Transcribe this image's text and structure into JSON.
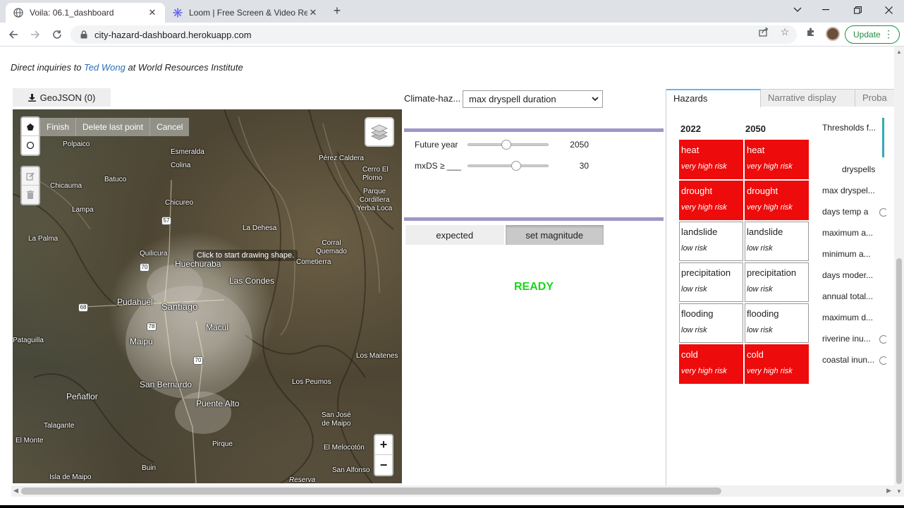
{
  "browser": {
    "tabs": [
      {
        "title": "Voila: 06.1_dashboard",
        "active": true
      },
      {
        "title": "Loom | Free Screen & Video Reco",
        "active": false
      }
    ],
    "url": "city-hazard-dashboard.herokuapp.com",
    "update_label": "Update"
  },
  "page": {
    "inquiry_prefix": "Direct inquiries to ",
    "inquiry_link": "Ted Wong",
    "inquiry_suffix": " at World Resources Institute"
  },
  "map": {
    "geojson_button": "GeoJSON (0)",
    "draw_actions": [
      "Finish",
      "Delete last point",
      "Cancel"
    ],
    "tooltip": "Click to start drawing shape.",
    "zoom_in": "+",
    "zoom_out": "−",
    "labels": {
      "polpaico": "Polpaico",
      "esmeralda": "Esmeralda",
      "colina": "Colina",
      "perez_caldera": "Pérez Caldera",
      "cerro_el_plomo": "Cerro El\nPlomo",
      "chicauma": "Chicauma",
      "batuco": "Batuco",
      "lampa": "Lampa",
      "parque_cordillera": "Parque\nCordillera\nYerba Loca",
      "chicureo": "Chicureo",
      "la_dehesa": "La Dehesa",
      "la_palma": "La Palma",
      "quilicura": "Quilicura",
      "huechuraba": "Huechuraba",
      "corral_quemado": "Corral\nQuemado",
      "cometierra": "Cometierra",
      "las_condes": "Las Condes",
      "pudahuel": "Pudahuel",
      "santiago": "Santiago",
      "macul": "Macul",
      "maipu": "Maipú",
      "pataguilla": "Pataguilla",
      "los_maitenes": "Los Maitenes",
      "san_bernardo": "San Bernardo",
      "los_peumos": "Los Peumos",
      "penaflor": "Peñaflor",
      "puente_alto": "Puente Alto",
      "talagante": "Talagante",
      "san_jose_de_maipo": "San José\nde Maipo",
      "el_monte": "El Monte",
      "pirque": "Pirque",
      "el_melocoton": "El Melocotón",
      "buin": "Buin",
      "san_alfonso": "San Alfonso",
      "isla_de_maipo": "Isla de Maipo",
      "reserva": "Reserva"
    },
    "road_shields": [
      "57",
      "70",
      "68",
      "78",
      "70",
      "5"
    ]
  },
  "controls": {
    "hazard_label": "Climate-haz...",
    "hazard_selected": "max dryspell duration",
    "future_year_label": "Future year",
    "future_year_value": "2050",
    "future_year_fraction": 0.47,
    "threshold_label": "mxDS ≥ ___",
    "threshold_value": "30",
    "threshold_fraction": 0.6,
    "toggle_expected": "expected",
    "toggle_magnitude": "set magnitude",
    "status": "READY",
    "status_color": "#19d719"
  },
  "right_panel": {
    "tabs": [
      "Hazards",
      "Narrative display",
      "Proba"
    ],
    "years": [
      "2022",
      "2050"
    ],
    "hazards": [
      {
        "name": "heat",
        "risk_2022": "very high risk",
        "risk_2050": "very high risk",
        "high_2022": true,
        "high_2050": true
      },
      {
        "name": "drought",
        "risk_2022": "very high risk",
        "risk_2050": "very high risk",
        "high_2022": true,
        "high_2050": true
      },
      {
        "name": "landslide",
        "risk_2022": "low risk",
        "risk_2050": "low risk",
        "high_2022": false,
        "high_2050": false
      },
      {
        "name": "precipitation",
        "risk_2022": "low risk",
        "risk_2050": "low risk",
        "high_2022": false,
        "high_2050": false
      },
      {
        "name": "flooding",
        "risk_2022": "low risk",
        "risk_2050": "low risk",
        "high_2022": false,
        "high_2050": false
      },
      {
        "name": "cold",
        "risk_2022": "very high risk",
        "risk_2050": "very high risk",
        "high_2022": true,
        "high_2050": true
      }
    ],
    "thresholds_title": "Thresholds f...",
    "dryspells_heading": "dryspells",
    "threshold_items": [
      "max dryspel...",
      "days temp a",
      "maximum a...",
      "minimum a...",
      "days moder...",
      "annual total...",
      "maximum d...",
      "riverine inu...",
      "coastal inun..."
    ],
    "high_risk_color": "#ee0b0b"
  }
}
